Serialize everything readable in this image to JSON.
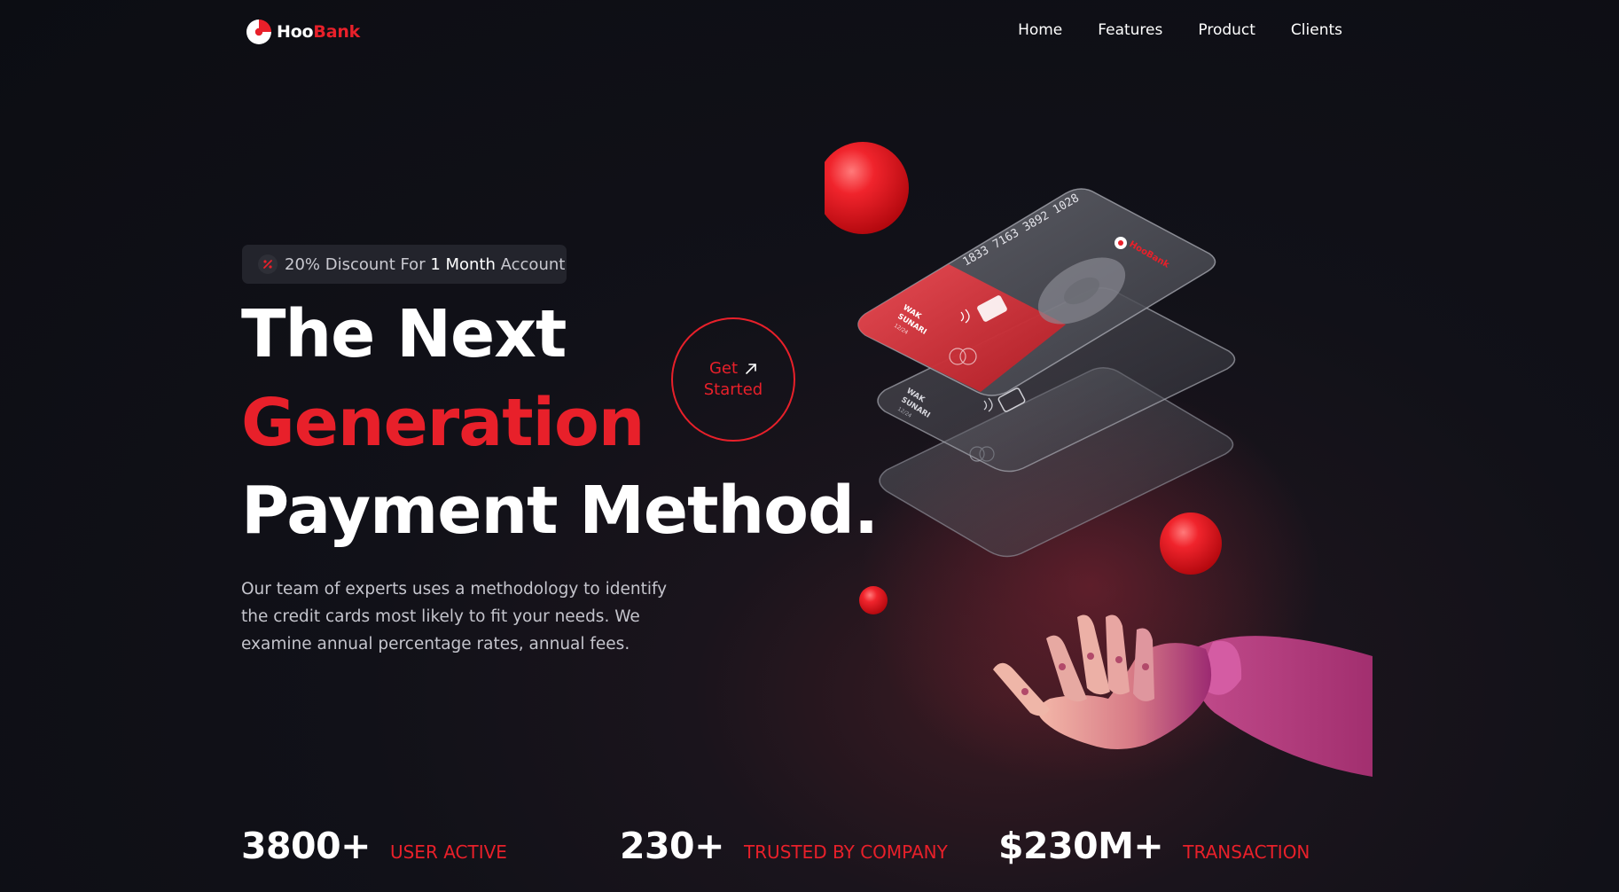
{
  "brand": {
    "name_part1": "Hoo",
    "name_part2": "Bank"
  },
  "nav": {
    "items": [
      {
        "label": "Home"
      },
      {
        "label": "Features"
      },
      {
        "label": "Product"
      },
      {
        "label": "Clients"
      }
    ]
  },
  "hero": {
    "badge": {
      "prefix": "20% Discount For ",
      "highlight": "1 Month",
      "suffix": " Account"
    },
    "headline_line1": "The Next",
    "headline_line2": "Generation",
    "headline_line3": "Payment Method.",
    "description": "Our team of experts uses a methodology to identify the credit cards most likely to fit your needs. We examine annual percentage rates, annual fees.",
    "cta_line1": "Get",
    "cta_line2": "Started"
  },
  "card_front": {
    "number": "1833 7163 3892 1028",
    "brand": "HooBank",
    "holder_line1": "WAK",
    "holder_line2": "SUNARI",
    "expiry": "12/24"
  },
  "card_middle": {
    "holder_line1": "WAK",
    "holder_line2": "SUNARI",
    "expiry": "12/24"
  },
  "stats": [
    {
      "value": "3800+",
      "label": "User Active"
    },
    {
      "value": "230+",
      "label": "Trusted by Company"
    },
    {
      "value": "$230M+",
      "label": "Transaction"
    }
  ],
  "colors": {
    "accent": "#e8202a",
    "background": "#0c0d13",
    "text": "#ffffff",
    "muted": "#c4c4cc",
    "badge_bg": "#23242c"
  },
  "icons": {
    "logo": "hoobank-logo-icon",
    "discount": "discount-icon",
    "cta_arrow": "arrow-up-right-icon"
  }
}
